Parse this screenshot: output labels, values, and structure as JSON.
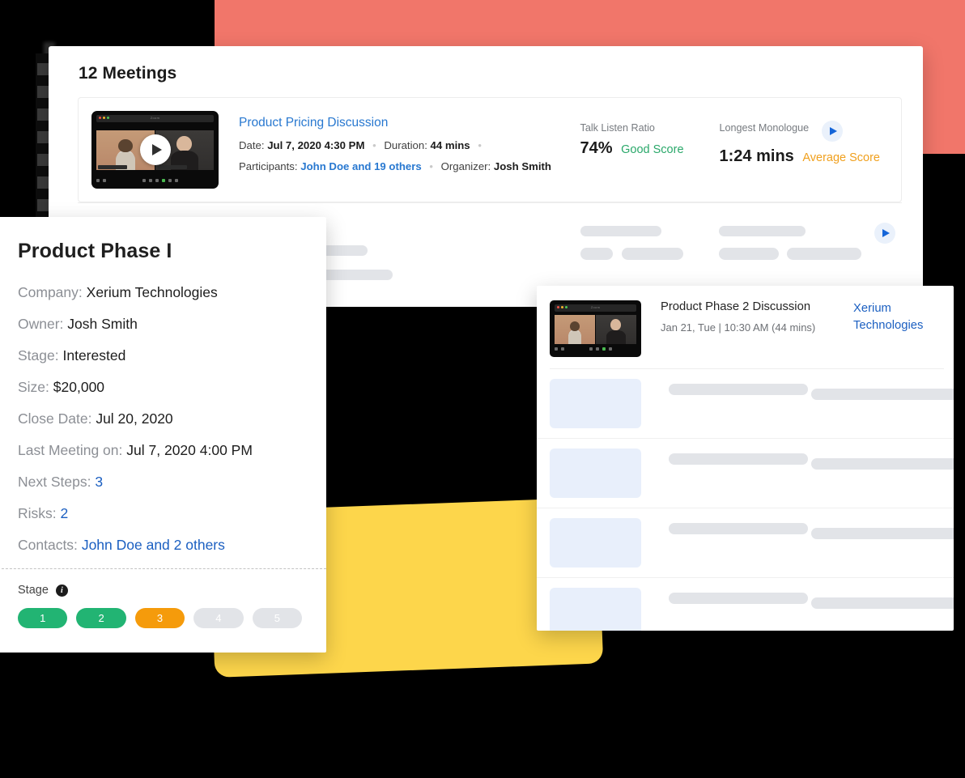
{
  "colors": {
    "coral": "#f1766a",
    "yellow": "#fdd64b",
    "link_blue": "#2878d0",
    "good_green": "#2aa86a",
    "average_orange": "#f0a01e",
    "pill_green": "#22b473",
    "pill_orange": "#f59b0b",
    "pill_grey": "#e2e4e8",
    "background": "#000000"
  },
  "meetings_panel": {
    "title": "12 Meetings",
    "meeting": {
      "name": "Product Pricing Discussion",
      "date_label": "Date:",
      "date_value": "Jul 7, 2020 4:30 PM",
      "duration_label": "Duration:",
      "duration_value": "44 mins",
      "participants_label": "Participants:",
      "participants_value": "John Doe and 19 others",
      "organizer_label": "Organizer:",
      "organizer_value": "Josh Smith",
      "separator": "•",
      "play_icon": "play-icon",
      "metrics": [
        {
          "label": "Talk Listen Ratio",
          "value": "74%",
          "score": "Good Score",
          "score_type": "good"
        },
        {
          "label": "Longest Monologue",
          "value": "1:24 mins",
          "score": "Average Score",
          "score_type": "average"
        }
      ]
    },
    "skeleton_rows": 3
  },
  "detail_panel": {
    "title": "Product Phase I",
    "fields": [
      {
        "key": "Company:",
        "value": "Xerium Technologies",
        "link": false
      },
      {
        "key": "Owner:",
        "value": "Josh Smith",
        "link": false
      },
      {
        "key": "Stage:",
        "value": "Interested",
        "link": false
      },
      {
        "key": "Size:",
        "value": "$20,000",
        "link": false
      },
      {
        "key": "Close Date:",
        "value": "Jul 20, 2020",
        "link": false
      },
      {
        "key": "Last Meeting on:",
        "value": "Jul 7, 2020 4:00 PM",
        "link": false
      },
      {
        "key": "Next Steps:",
        "value": "3",
        "link": true
      },
      {
        "key": "Risks:",
        "value": "2",
        "link": true
      },
      {
        "key": "Contacts:",
        "value": "John Doe and 2 others",
        "link": true
      }
    ],
    "stage_section": {
      "label": "Stage",
      "info_icon": "info-icon",
      "info_glyph": "i",
      "pills": [
        {
          "label": "1",
          "state": "green"
        },
        {
          "label": "2",
          "state": "green"
        },
        {
          "label": "3",
          "state": "orange"
        },
        {
          "label": "4",
          "state": "grey"
        },
        {
          "label": "5",
          "state": "grey"
        }
      ]
    }
  },
  "right_panel": {
    "meeting_title": "Product Phase 2 Discussion",
    "meeting_subtitle": "Jan 21, Tue | 10:30 AM (44 mins)",
    "company": "Xerium Technologies",
    "skeleton_rows": 4
  }
}
